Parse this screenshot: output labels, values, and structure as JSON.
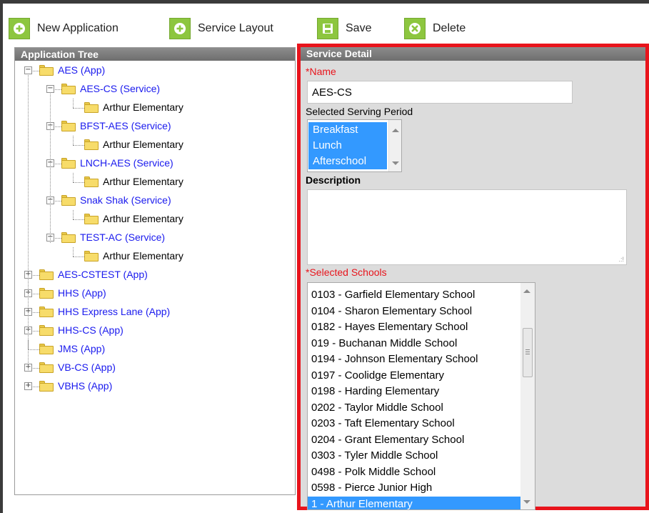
{
  "toolbar": {
    "new_application": "New Application",
    "service_layout": "Service Layout",
    "save": "Save",
    "delete": "Delete",
    "accent_color": "#8dc63f"
  },
  "application_tree": {
    "title": "Application Tree",
    "nodes": [
      {
        "label": "AES (App)",
        "toggle": "−"
      },
      {
        "label": "AES-CS (Service)",
        "toggle": "−"
      },
      {
        "label": "Arthur Elementary"
      },
      {
        "label": "BFST-AES (Service)",
        "toggle": "−"
      },
      {
        "label": "Arthur Elementary"
      },
      {
        "label": "LNCH-AES (Service)",
        "toggle": "−"
      },
      {
        "label": "Arthur Elementary"
      },
      {
        "label": "Snak Shak (Service)",
        "toggle": "−"
      },
      {
        "label": "Arthur Elementary"
      },
      {
        "label": "TEST-AC (Service)",
        "toggle": "−"
      },
      {
        "label": "Arthur Elementary"
      },
      {
        "label": "AES-CSTEST (App)",
        "toggle": "+"
      },
      {
        "label": "HHS (App)",
        "toggle": "+"
      },
      {
        "label": "HHS Express Lane (App)",
        "toggle": "+"
      },
      {
        "label": "HHS-CS (App)",
        "toggle": "+"
      },
      {
        "label": "JMS (App)"
      },
      {
        "label": "VB-CS (App)",
        "toggle": "+"
      },
      {
        "label": "VBHS (App)",
        "toggle": "+"
      }
    ]
  },
  "service_detail": {
    "title": "Service Detail",
    "name_required": "*",
    "name_label": "Name",
    "name_value": "AES-CS",
    "serving_period_label": "Selected Serving Period",
    "serving_periods": [
      "Breakfast",
      "Lunch",
      "Afterschool"
    ],
    "description_label": "Description",
    "description_value": "",
    "schools_required": "*",
    "schools_label": "Selected Schools",
    "schools": [
      "0103 - Garfield Elementary School",
      "0104 - Sharon Elementary School",
      "0182 - Hayes Elementary School",
      "019 - Buchanan Middle School",
      "0194 - Johnson Elementary School",
      "0197 - Coolidge Elementary",
      "0198 - Harding Elementary",
      "0202 - Taylor Middle School",
      "0203 - Taft Elementary School",
      "0204 - Grant Elementary School",
      "0303 - Tyler Middle School",
      "0498 - Polk Middle School",
      "0598 - Pierce Junior High",
      "1 - Arthur Elementary"
    ],
    "selected_school": "1 - Arthur Elementary",
    "highlight_color": "#e8141c",
    "selection_color": "#3399ff"
  }
}
